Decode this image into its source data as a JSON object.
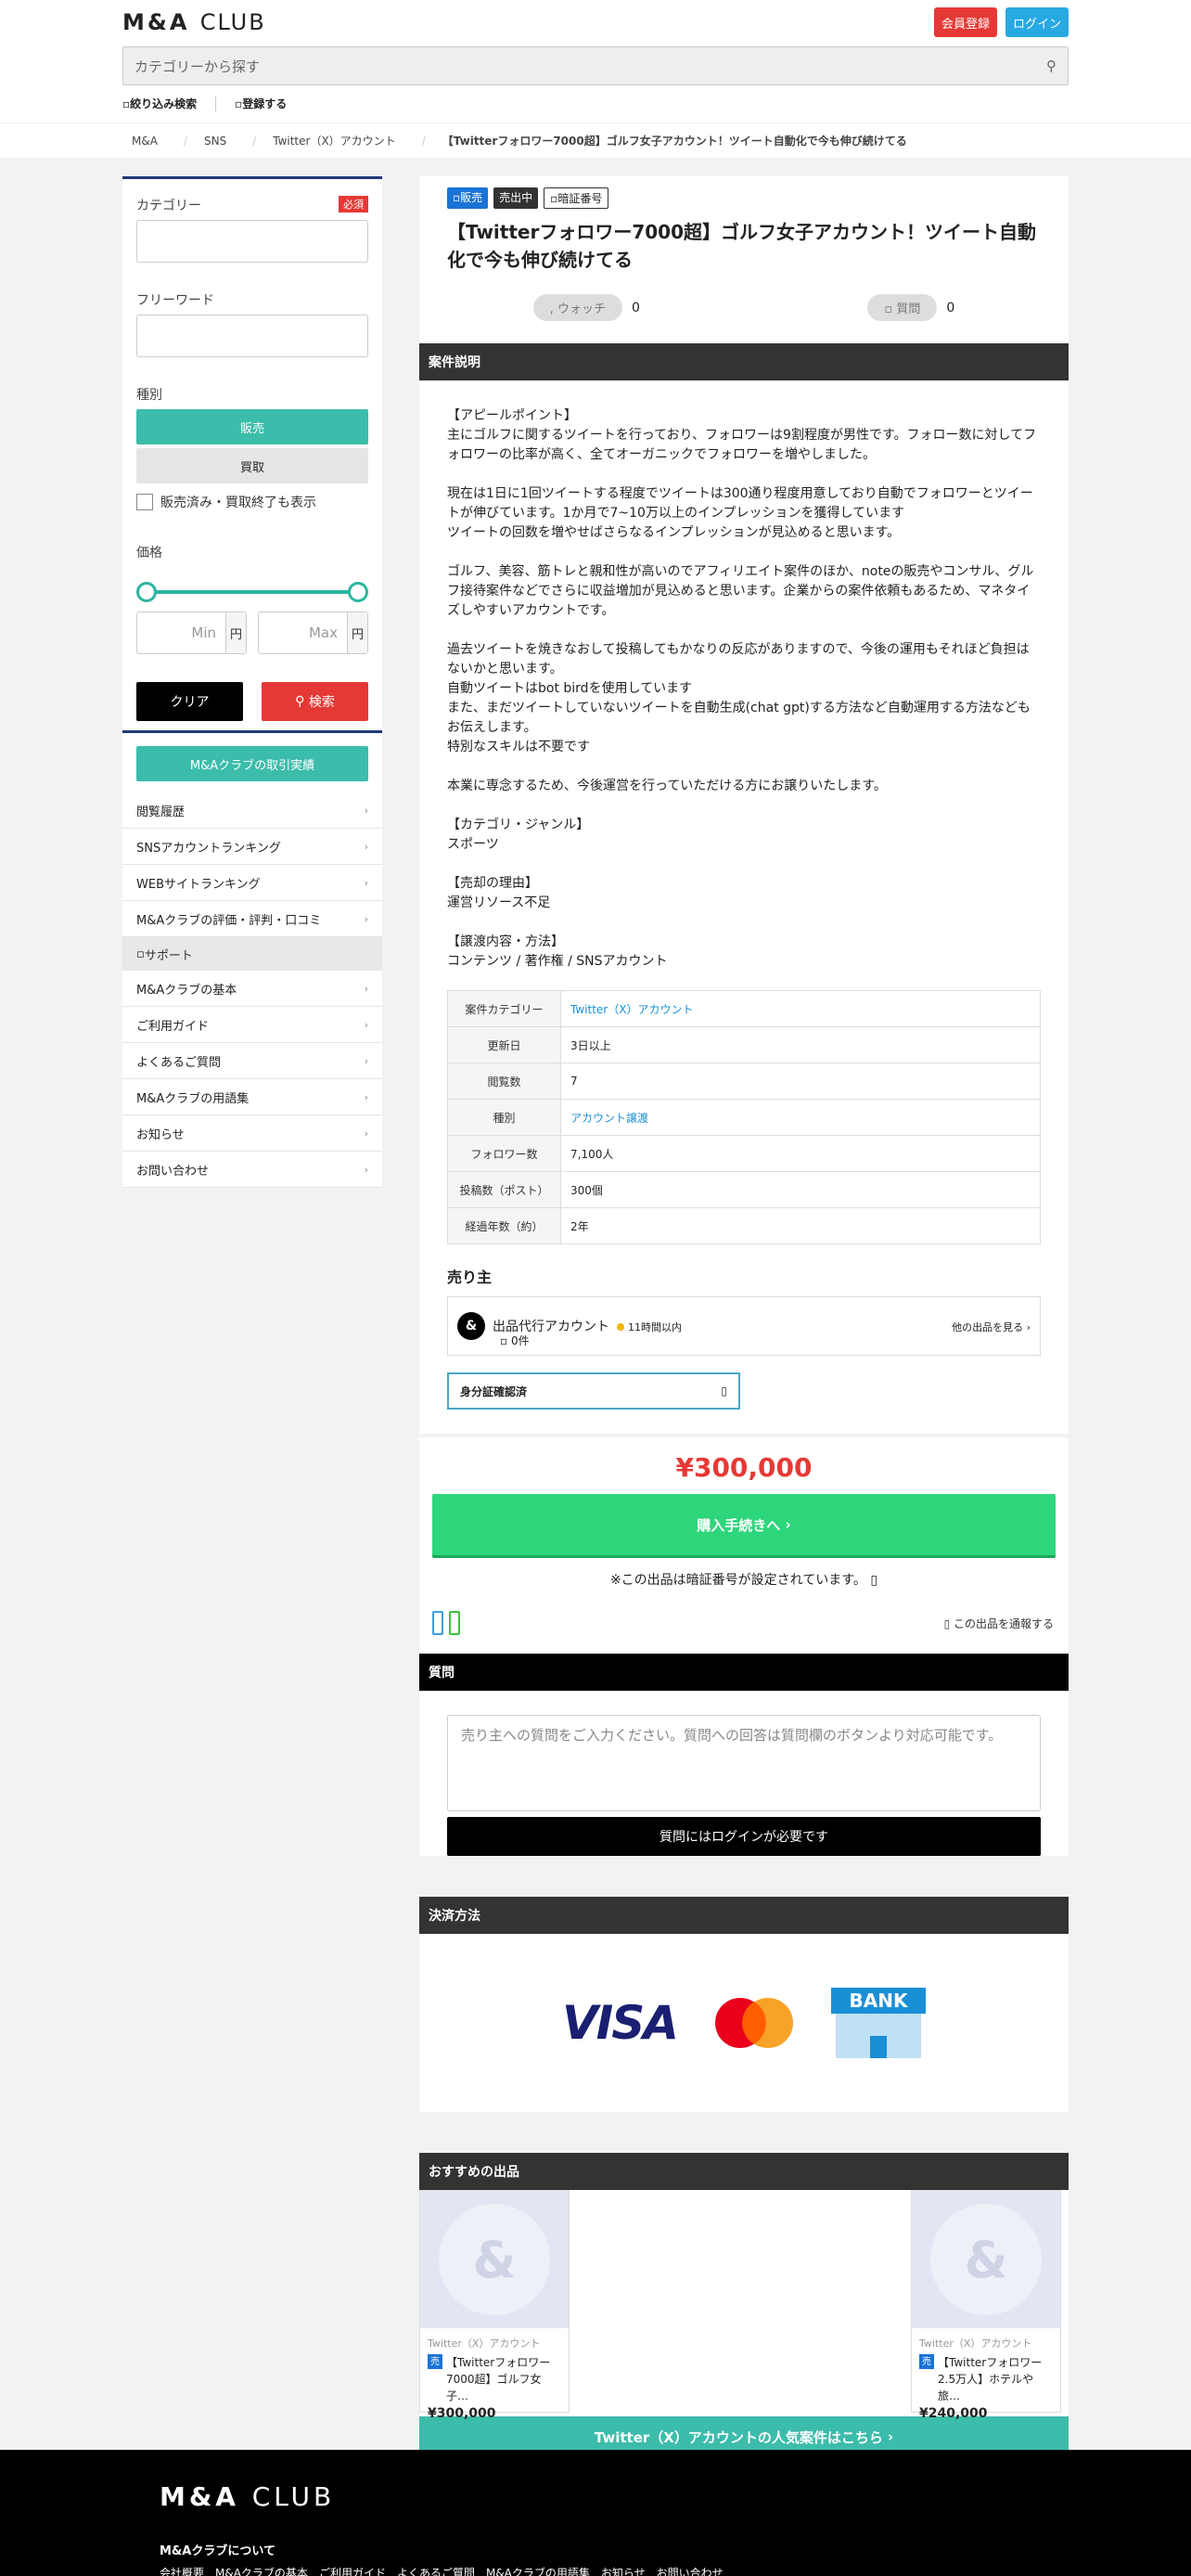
{
  "header": {
    "logo_main": "M&A",
    "logo_sub": "CLUB",
    "register_label": "会員登録",
    "login_label": "ログイン",
    "search_placeholder": "カテゴリーから探す",
    "search_icon": "search-icon",
    "filter_label": "絞り込み検索",
    "save_label": "登録する"
  },
  "breadcrumb": [
    "M&A",
    "SNS",
    "Twitter（X）アカウント",
    "【Twitterフォロワー7000超】ゴルフ女子アカウント！ツイート自動化で今も伸び続けてる"
  ],
  "sidebar": {
    "category_label": "カテゴリー",
    "required_label": "必須",
    "freeword_label": "フリーワード",
    "type_label": "種別",
    "type_sell": "販売",
    "type_buy": "買取",
    "include_closed": "販売済み・買取終了も表示",
    "price_label": "価格",
    "min_placeholder": "Min",
    "max_placeholder": "Max",
    "yen": "円",
    "clear_label": "クリア",
    "search_label": "検索",
    "achievements_label": "M&Aクラブの取引実績",
    "menu": [
      "閲覧履歴",
      "SNSアカウントランキング",
      "WEBサイトランキング",
      "M&Aクラブの評価・評判・口コミ"
    ],
    "support_label": "サポート",
    "support_menu": [
      "M&Aクラブの基本",
      "ご利用ガイド",
      "よくあるご質問",
      "M&Aクラブの用語集",
      "お知らせ",
      "お問い合わせ"
    ]
  },
  "listing": {
    "tag_sale": "販売",
    "tag_status": "売出中",
    "tag_pin": "暗証番号",
    "title": "【Twitterフォロワー7000超】ゴルフ女子アカウント！ツイート自動化で今も伸び続けてる",
    "watch_label": "ウォッチ",
    "watch_count": "0",
    "question_label": "質問",
    "question_count": "0",
    "desc_header": "案件説明",
    "desc": [
      "【アピールポイント】\n主にゴルフに関するツイートを行っており、フォロワーは9割程度が男性です。フォロー数に対してフォロワーの比率が高く、全てオーガニックでフォロワーを増やしました。",
      "現在は1日に1回ツイートする程度でツイートは300通り程度用意しており自動でフォロワーとツイートが伸びています。1か月で7~10万以上のインプレッションを獲得しています\nツイートの回数を増やせばさらなるインプレッションが見込めると思います。",
      "ゴルフ、美容、筋トレと親和性が高いのでアフィリエイト案件のほか、noteの販売やコンサル、グルフ接待案件などでさらに収益増加が見込めると思います。企業からの案件依頼もあるため、マネタイズしやすいアカウントです。",
      "過去ツイートを焼きなおして投稿してもかなりの反応がありますので、今後の運用もそれほど負担はないかと思います。\n自動ツイートはbot birdを使用しています\nまた、まだツイートしていないツイートを自動生成(chat gpt)する方法など自動運用する方法などもお伝えします。\n特別なスキルは不要です",
      "本業に専念するため、今後運営を行っていただける方にお譲りいたします。",
      "【カテゴリ・ジャンル】\nスポーツ",
      "【売却の理由】\n運営リソース不足",
      "【譲渡内容・方法】\nコンテンツ / 著作権 / SNSアカウント"
    ],
    "specs": [
      {
        "k": "案件カテゴリー",
        "v": "Twitter（X）アカウント",
        "link": true
      },
      {
        "k": "更新日",
        "v": "3日以上",
        "link": false
      },
      {
        "k": "閲覧数",
        "v": "7",
        "link": false
      },
      {
        "k": "種別",
        "v": "アカウント譲渡",
        "link": true
      },
      {
        "k": "フォロワー数",
        "v": "7,100人",
        "link": false
      },
      {
        "k": "投稿数（ポスト）",
        "v": "300個",
        "link": false
      },
      {
        "k": "経過年数（約）",
        "v": "2年",
        "link": false
      }
    ],
    "seller_header": "売り主",
    "seller_name": "出品代行アカウント",
    "seller_response": "11時間以内",
    "seller_count": "0件",
    "other_listings": "他の出品を見る",
    "id_verify": "身分証確認済",
    "price": "¥300,000",
    "buy_label": "購入手続きへ",
    "pin_note": "※この出品は暗証番号が設定されています。",
    "report_label": "この出品を通報する",
    "qa_header": "質問",
    "qa_placeholder": "売り主への質問をご入力ください。質問への回答は質問欄のボタンより対応可能です。",
    "qa_login": "質問にはログインが必要です",
    "payment_header": "決済方法",
    "pay_visa": "VISA",
    "pay_bank": "BANK",
    "recommend_header": "おすすめの出品",
    "recs": [
      {
        "cat": "Twitter（X）アカウント",
        "badge": "売",
        "title": "【Twitterフォロワー7000超】ゴルフ女子…",
        "price": "¥300,000"
      },
      {
        "cat": "Twitter（X）アカウント",
        "badge": "売",
        "title": "【Twitterフォロワー2.5万人】ホテルや旅…",
        "price": "¥240,000"
      }
    ],
    "popular_label": "Twitter（X）アカウントの人気案件はこちら"
  },
  "footer": {
    "logo_main": "M&A",
    "logo_sub": "CLUB",
    "about": "M&Aクラブについて",
    "links": [
      "会社概要",
      "M&Aクラブの基本",
      "ご利用ガイド",
      "よくあるご質問",
      "M&Aクラブの用語集",
      "お知らせ",
      "お問い合わせ"
    ]
  }
}
